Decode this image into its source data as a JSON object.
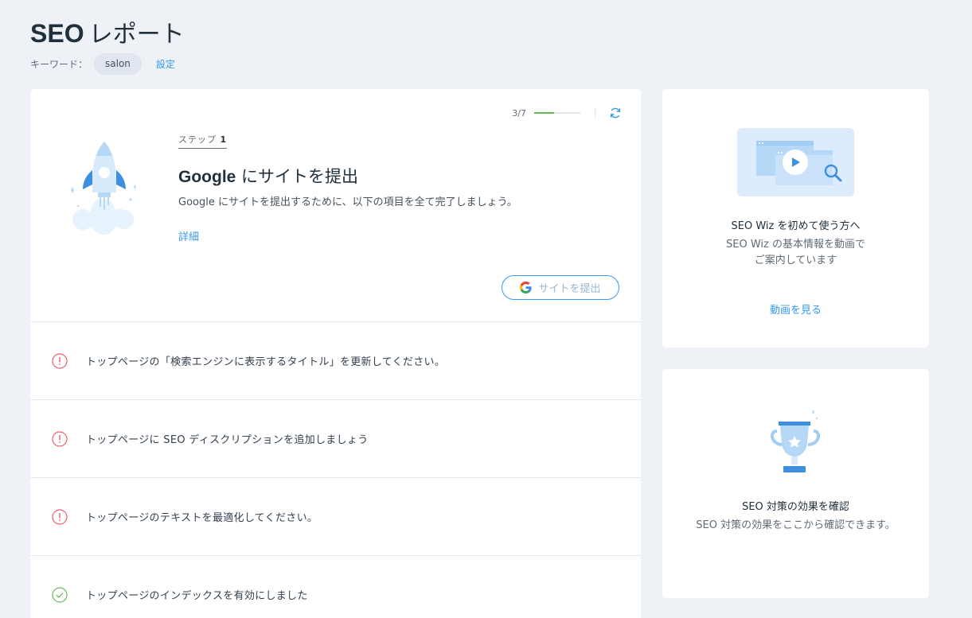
{
  "header": {
    "title_bold": "SEO",
    "title_rest": "レポート",
    "keyword_label": "キーワード：",
    "keyword": "salon",
    "settings_link": "設定"
  },
  "main": {
    "progress_text": "3/7",
    "progress_fraction": 0.43,
    "step_label": "ステップ",
    "step_number": "1",
    "step_title_bold": "Google",
    "step_title_rest": "にサイトを提出",
    "step_description": "Google にサイトを提出するために、以下の項目を全て完了しましょう。",
    "details_link": "詳細",
    "submit_button": "サイトを提出",
    "tasks": [
      {
        "status": "error",
        "text": "トップページの「検索エンジンに表示するタイトル」を更新してください。"
      },
      {
        "status": "error",
        "text": "トップページに SEO ディスクリプションを追加しましょう"
      },
      {
        "status": "error",
        "text": "トップページのテキストを最適化してください。"
      },
      {
        "status": "done",
        "text": "トップページのインデックスを有効にしました"
      }
    ]
  },
  "side": {
    "video_card": {
      "title": "SEO Wiz を初めて使う方へ",
      "description": "SEO Wiz の基本情報を動画でご案内しています",
      "link": "動画を見る"
    },
    "results_card": {
      "title": "SEO 対策の効果を確認",
      "description": "SEO 対策の効果をここから確認できます。"
    }
  },
  "colors": {
    "accent": "#3899ec",
    "error": "#ee5a6f",
    "success": "#60bc57",
    "background": "#eef1f6"
  }
}
